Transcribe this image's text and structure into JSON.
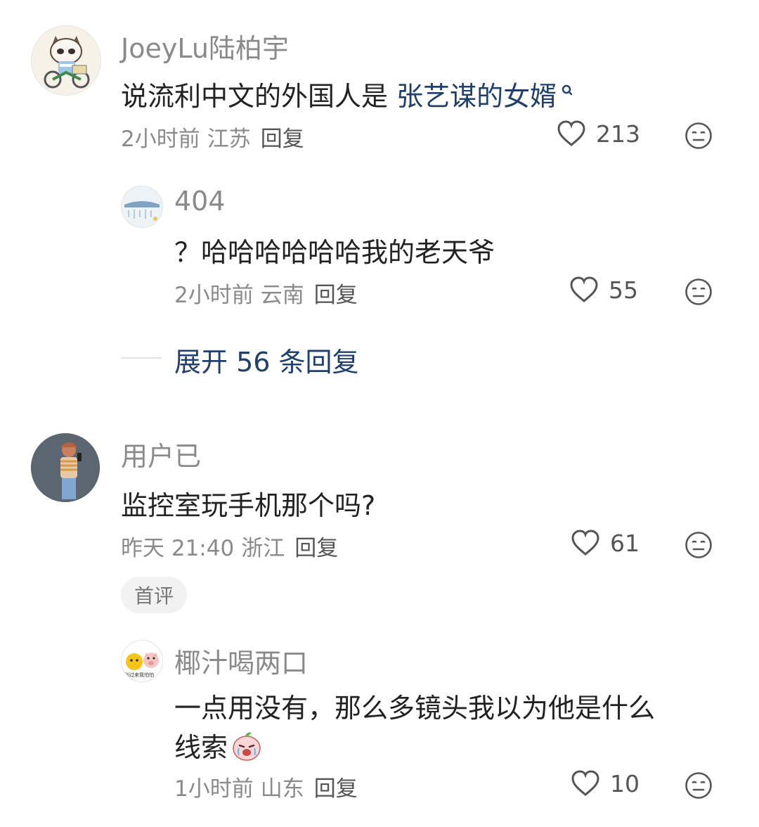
{
  "comments": [
    {
      "name": "JoeyLu陆柏宇",
      "text_prefix": "说流利中文的外国人是 ",
      "text_link": "张艺谋的女婿",
      "time": "2小时前",
      "location": "江苏",
      "reply": "回复",
      "likes": "213"
    },
    {
      "name": "404",
      "text": "？哈哈哈哈哈哈我的老天爷",
      "time": "2小时前",
      "location": "云南",
      "reply": "回复",
      "likes": "55"
    },
    {
      "expand": "展开 56 条回复"
    },
    {
      "name": "用户已",
      "text": "监控室玩手机那个吗?",
      "time": "昨天 21:40",
      "location": "浙江",
      "reply": "回复",
      "likes": "61",
      "badge": "首评"
    },
    {
      "name": "椰汁喝两口",
      "text_line1": "一点用没有，那么多镜头我以为他是什么",
      "text_line2": "线索",
      "time": "1小时前",
      "location": "山东",
      "reply": "回复",
      "likes": "10",
      "avatar_text": "别过来我怕怕"
    }
  ],
  "icons": {
    "like": "heart-outline-icon",
    "more": "neutral-face-icon",
    "search": "search-icon",
    "emoji": "crying-peach-emoji"
  },
  "colors": {
    "link": "#1f3f6e",
    "secondary": "#8a8a8a",
    "primary": "#222222"
  }
}
